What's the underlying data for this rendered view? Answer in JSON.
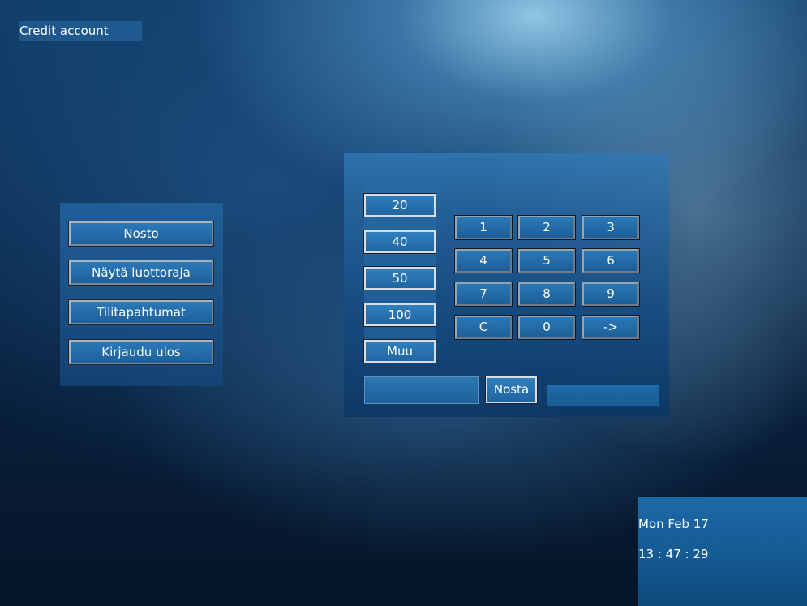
{
  "window": {
    "title": "Credit account"
  },
  "menu": {
    "items": [
      {
        "label": "Nosto"
      },
      {
        "label": "Näytä luottoraja"
      },
      {
        "label": "Tilitapahtumat"
      },
      {
        "label": "Kirjaudu ulos"
      }
    ]
  },
  "withdraw": {
    "amounts": [
      {
        "label": "20"
      },
      {
        "label": "40"
      },
      {
        "label": "50"
      },
      {
        "label": "100"
      },
      {
        "label": "Muu"
      }
    ],
    "keypad": [
      {
        "label": "1"
      },
      {
        "label": "2"
      },
      {
        "label": "3"
      },
      {
        "label": "4"
      },
      {
        "label": "5"
      },
      {
        "label": "6"
      },
      {
        "label": "7"
      },
      {
        "label": "8"
      },
      {
        "label": "9"
      },
      {
        "label": "C"
      },
      {
        "label": "0"
      },
      {
        "label": "->"
      }
    ],
    "amount_input_value": "",
    "submit_label": "Nosta",
    "result_text": ""
  },
  "clock": {
    "date": "Mon Feb 17",
    "time": "13 : 47 : 29"
  },
  "colors": {
    "background_dark": "#081f3b",
    "panel_blue": "#1e5f99",
    "text": "#ffffff"
  }
}
